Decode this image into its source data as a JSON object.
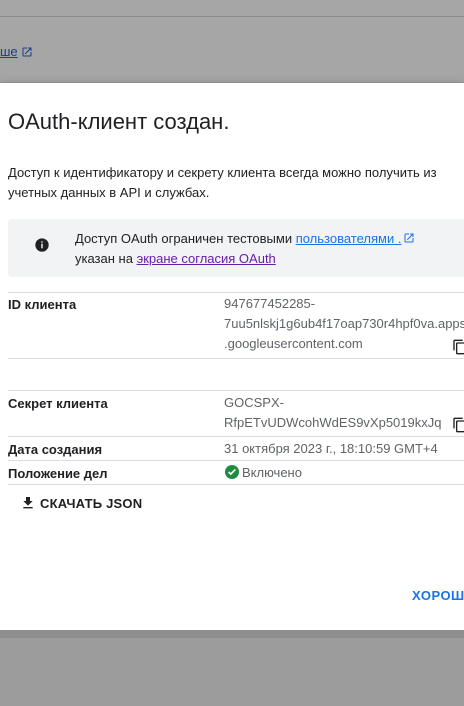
{
  "backdrop": {
    "link_text": "ше"
  },
  "dialog": {
    "title": "OAuth-клиент создан.",
    "description": "Доступ к идентификатору и секрету клиента всегда можно получить из учетных данных в API и службах.",
    "notice": {
      "text_before": "Доступ OAuth ограничен тестовыми ",
      "link_users": "пользователями .",
      "text_middle": "указан на ",
      "link_consent": "экране согласия OAuth"
    },
    "fields": {
      "client_id_label": "ID клиента",
      "client_id_line1": "947677452285-",
      "client_id_line2": "7uu5nlskj1g6ub4f17oap730r4hpf0va.apps",
      "client_id_line3": ".googleusercontent.com",
      "secret_label": "Секрет клиента",
      "secret_line1": "GOCSPX-",
      "secret_line2": "RfpETvUDWcohWdES9vXp5019kxJq",
      "created_label": "Дата создания",
      "created_value": "31 октября 2023 г., 18:10:59 GMT+4",
      "status_label": "Положение дел",
      "status_value": "Включено"
    },
    "download_label": "СКАЧАТЬ JSON",
    "ok_label": "ХОРОШО"
  },
  "colors": {
    "accent": "#1a73e8",
    "visited_link": "#681da8",
    "success": "#1e8e3e",
    "scrim": "#999999"
  },
  "icons": {
    "notice": "info-icon",
    "copy": "copy-icon",
    "external": "external-link-icon",
    "download": "download-icon",
    "status": "check-circle-icon"
  }
}
